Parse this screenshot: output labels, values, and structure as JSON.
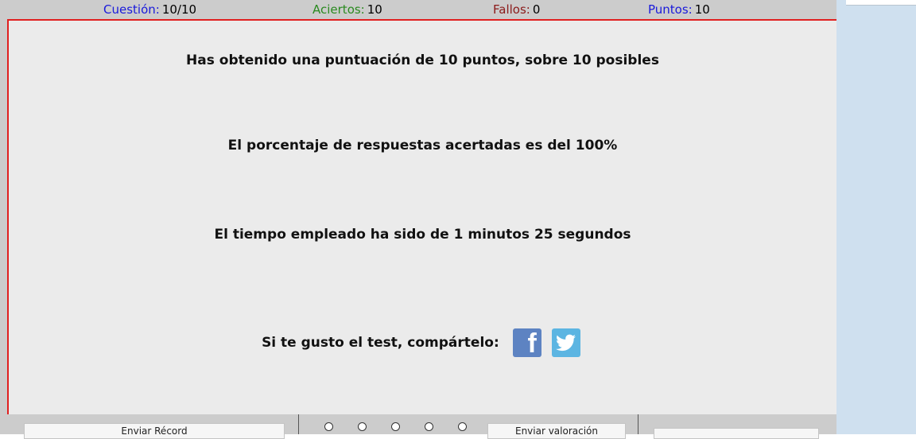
{
  "stats": {
    "cuestion": {
      "label": "Cuestión:",
      "value": "10/10"
    },
    "aciertos": {
      "label": "Aciertos:",
      "value": "10"
    },
    "fallos": {
      "label": "Fallos:",
      "value": "0"
    },
    "puntos": {
      "label": "Puntos:",
      "value": "10"
    }
  },
  "result": {
    "score_line": "Has obtenido una puntuación de 10 puntos, sobre 10 posibles",
    "percent_line": "El porcentaje de respuestas acertadas es del 100%",
    "time_line": "El tiempo empleado ha sido de 1 minutos 25 segundos",
    "share_label": "Si te gusto el test, compártelo:"
  },
  "bottom": {
    "record_button": "Enviar Récord",
    "rating_button": "Enviar valoración",
    "rating_options": 5
  },
  "icons": [
    "facebook-icon",
    "twitter-icon"
  ],
  "colors": {
    "label_blue": "#1a1adb",
    "label_green": "#2a8a1f",
    "label_red": "#8b1a1a",
    "border_red": "#e02020"
  }
}
